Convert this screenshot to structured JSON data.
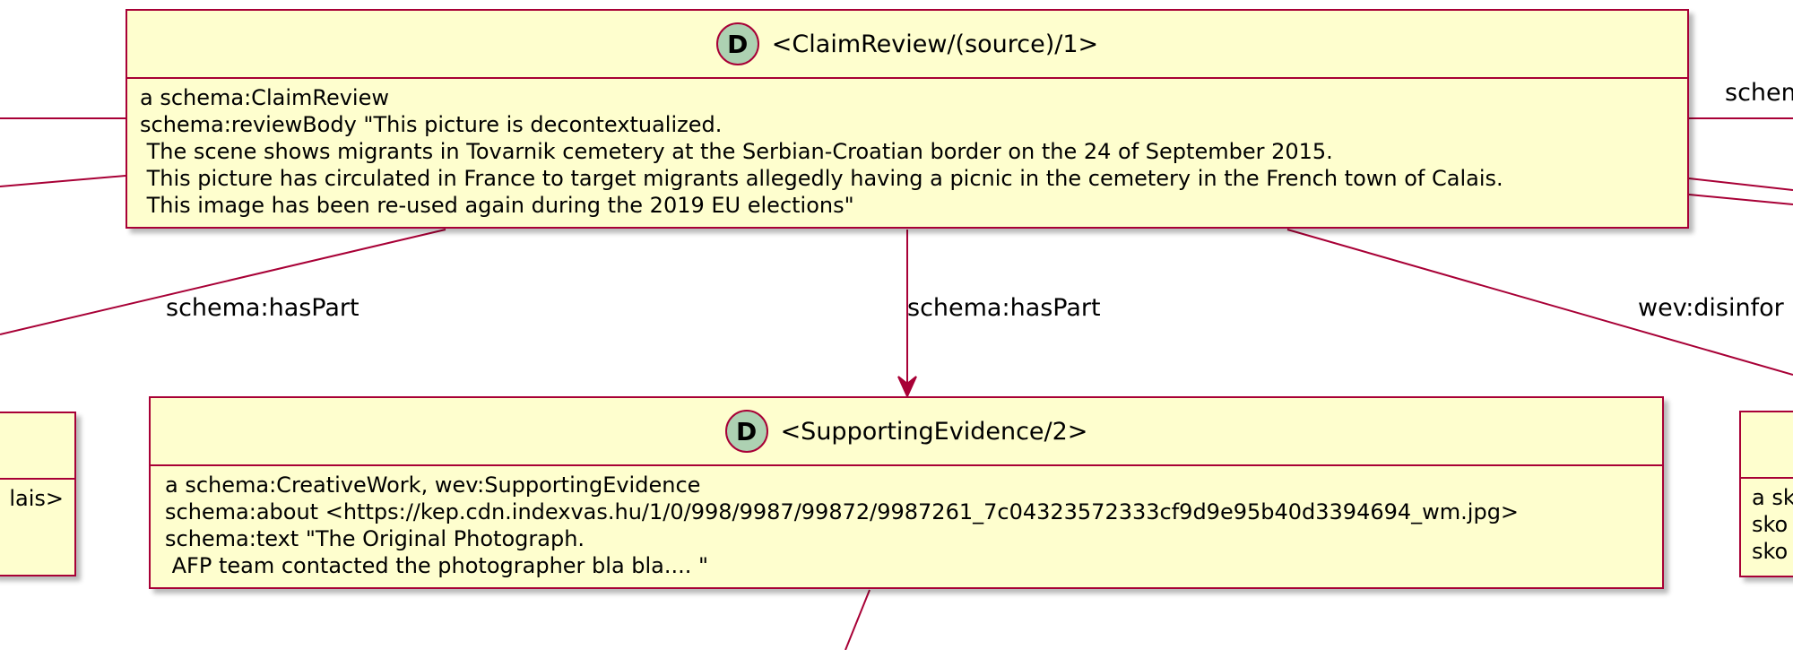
{
  "colors": {
    "node_fill": "#FEFECE",
    "border": "#A80036",
    "badge_fill": "#ADD1B2"
  },
  "nodes": {
    "claimreview": {
      "badge": "D",
      "title": "<ClaimReview/(source)/1>",
      "lines": [
        "a schema:ClaimReview",
        "schema:reviewBody \"This picture is decontextualized.",
        " The scene shows migrants in Tovarnik cemetery at the Serbian-Croatian border on the 24 of September 2015.",
        " This picture has circulated in France to target migrants allegedly having a picnic in the cemetery in the French town of Calais.",
        " This image has been re-used again during the 2019 EU elections\""
      ]
    },
    "supporting": {
      "badge": "D",
      "title": "<SupportingEvidence/2>",
      "lines": [
        "a schema:CreativeWork, wev:SupportingEvidence",
        "schema:about <https://kep.cdn.indexvas.hu/1/0/998/9987/99872/9987261_7c04323572333cf9d9e95b40d3394694_wm.jpg>",
        "schema:text \"The Original Photograph.",
        " AFP team contacted the photographer bla bla.... \""
      ]
    },
    "left_partial": {
      "lines": [
        "lais>"
      ]
    },
    "right_partial": {
      "lines": [
        "a sk",
        "sko",
        "sko"
      ]
    }
  },
  "edge_labels": {
    "haspart_left": "schema:hasPart",
    "haspart_center": "schema:hasPart",
    "disinfo_right": "wev:disinfor",
    "schema_top_right": "schem"
  }
}
